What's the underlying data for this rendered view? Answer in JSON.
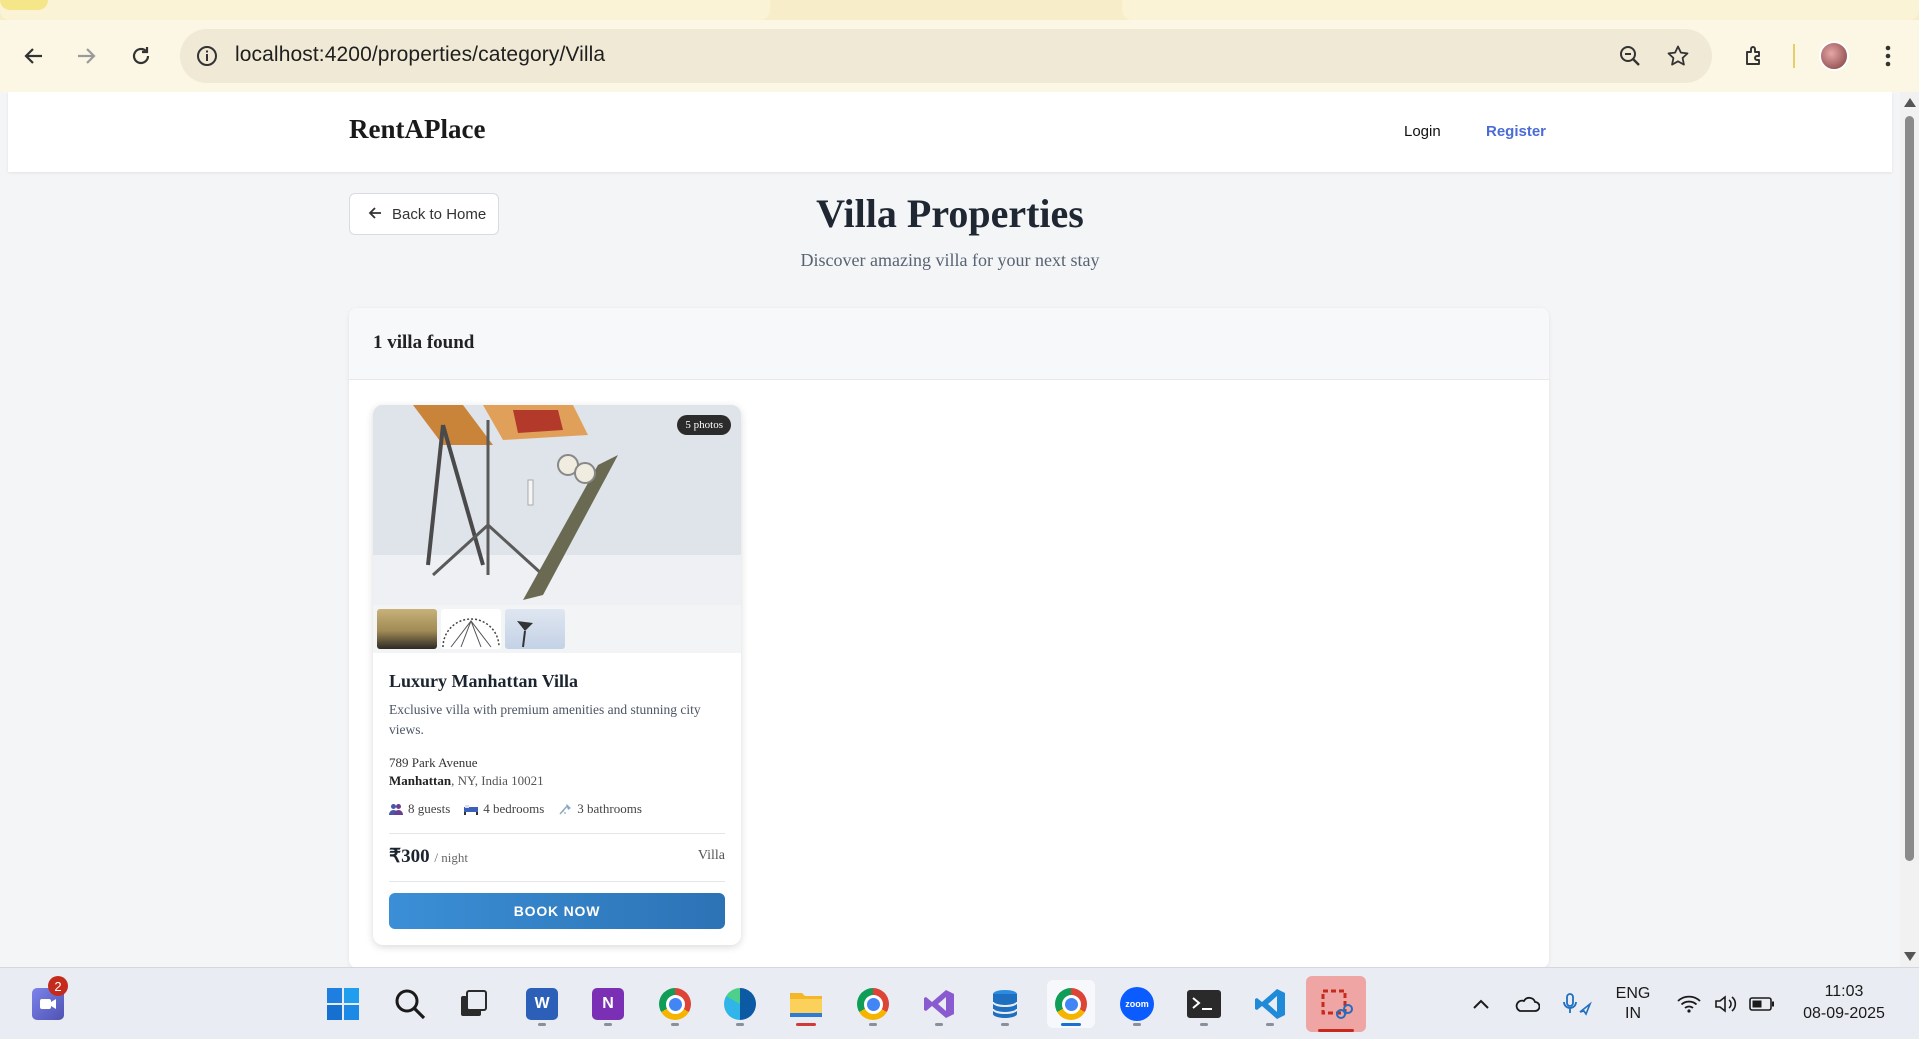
{
  "browser": {
    "url_host": "localhost",
    "url_path": ":4200/properties/category/Villa"
  },
  "site": {
    "logo": "RentAPlace",
    "nav": {
      "login": "Login",
      "register": "Register"
    }
  },
  "page": {
    "back_label": "Back to Home",
    "title": "Villa Properties",
    "subtitle": "Discover amazing villa for your next stay",
    "results_count": "1 villa found"
  },
  "listing": {
    "photo_badge": "5 photos",
    "title": "Luxury Manhattan Villa",
    "description": "Exclusive villa with premium amenities and stunning city views.",
    "street": "789 Park Avenue",
    "city": "Manhattan",
    "region": ", NY, India 10021",
    "amenities": {
      "guests": "8 guests",
      "bedrooms": "4 bedrooms",
      "bathrooms": "3 bathrooms"
    },
    "price": "₹300",
    "price_unit": "/ night",
    "type": "Villa",
    "book_label": "BOOK NOW"
  },
  "taskbar": {
    "notification_count": "2",
    "lang_line1": "ENG",
    "lang_line2": "IN",
    "time": "11:03",
    "date": "08-09-2025"
  },
  "colors": {
    "accent_register": "#4b6bd6",
    "book_button": "#3b8fd6",
    "title_text": "#1f2733"
  }
}
